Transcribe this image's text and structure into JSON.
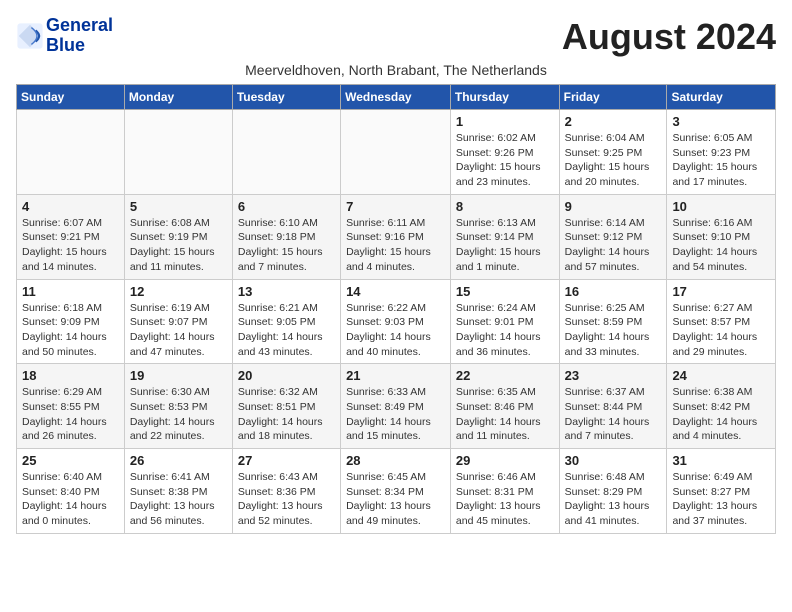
{
  "logo": {
    "line1": "General",
    "line2": "Blue"
  },
  "title": "August 2024",
  "subtitle": "Meerveldhoven, North Brabant, The Netherlands",
  "header_days": [
    "Sunday",
    "Monday",
    "Tuesday",
    "Wednesday",
    "Thursday",
    "Friday",
    "Saturday"
  ],
  "weeks": [
    [
      {
        "day": "",
        "detail": ""
      },
      {
        "day": "",
        "detail": ""
      },
      {
        "day": "",
        "detail": ""
      },
      {
        "day": "",
        "detail": ""
      },
      {
        "day": "1",
        "detail": "Sunrise: 6:02 AM\nSunset: 9:26 PM\nDaylight: 15 hours\nand 23 minutes."
      },
      {
        "day": "2",
        "detail": "Sunrise: 6:04 AM\nSunset: 9:25 PM\nDaylight: 15 hours\nand 20 minutes."
      },
      {
        "day": "3",
        "detail": "Sunrise: 6:05 AM\nSunset: 9:23 PM\nDaylight: 15 hours\nand 17 minutes."
      }
    ],
    [
      {
        "day": "4",
        "detail": "Sunrise: 6:07 AM\nSunset: 9:21 PM\nDaylight: 15 hours\nand 14 minutes."
      },
      {
        "day": "5",
        "detail": "Sunrise: 6:08 AM\nSunset: 9:19 PM\nDaylight: 15 hours\nand 11 minutes."
      },
      {
        "day": "6",
        "detail": "Sunrise: 6:10 AM\nSunset: 9:18 PM\nDaylight: 15 hours\nand 7 minutes."
      },
      {
        "day": "7",
        "detail": "Sunrise: 6:11 AM\nSunset: 9:16 PM\nDaylight: 15 hours\nand 4 minutes."
      },
      {
        "day": "8",
        "detail": "Sunrise: 6:13 AM\nSunset: 9:14 PM\nDaylight: 15 hours\nand 1 minute."
      },
      {
        "day": "9",
        "detail": "Sunrise: 6:14 AM\nSunset: 9:12 PM\nDaylight: 14 hours\nand 57 minutes."
      },
      {
        "day": "10",
        "detail": "Sunrise: 6:16 AM\nSunset: 9:10 PM\nDaylight: 14 hours\nand 54 minutes."
      }
    ],
    [
      {
        "day": "11",
        "detail": "Sunrise: 6:18 AM\nSunset: 9:09 PM\nDaylight: 14 hours\nand 50 minutes."
      },
      {
        "day": "12",
        "detail": "Sunrise: 6:19 AM\nSunset: 9:07 PM\nDaylight: 14 hours\nand 47 minutes."
      },
      {
        "day": "13",
        "detail": "Sunrise: 6:21 AM\nSunset: 9:05 PM\nDaylight: 14 hours\nand 43 minutes."
      },
      {
        "day": "14",
        "detail": "Sunrise: 6:22 AM\nSunset: 9:03 PM\nDaylight: 14 hours\nand 40 minutes."
      },
      {
        "day": "15",
        "detail": "Sunrise: 6:24 AM\nSunset: 9:01 PM\nDaylight: 14 hours\nand 36 minutes."
      },
      {
        "day": "16",
        "detail": "Sunrise: 6:25 AM\nSunset: 8:59 PM\nDaylight: 14 hours\nand 33 minutes."
      },
      {
        "day": "17",
        "detail": "Sunrise: 6:27 AM\nSunset: 8:57 PM\nDaylight: 14 hours\nand 29 minutes."
      }
    ],
    [
      {
        "day": "18",
        "detail": "Sunrise: 6:29 AM\nSunset: 8:55 PM\nDaylight: 14 hours\nand 26 minutes."
      },
      {
        "day": "19",
        "detail": "Sunrise: 6:30 AM\nSunset: 8:53 PM\nDaylight: 14 hours\nand 22 minutes."
      },
      {
        "day": "20",
        "detail": "Sunrise: 6:32 AM\nSunset: 8:51 PM\nDaylight: 14 hours\nand 18 minutes."
      },
      {
        "day": "21",
        "detail": "Sunrise: 6:33 AM\nSunset: 8:49 PM\nDaylight: 14 hours\nand 15 minutes."
      },
      {
        "day": "22",
        "detail": "Sunrise: 6:35 AM\nSunset: 8:46 PM\nDaylight: 14 hours\nand 11 minutes."
      },
      {
        "day": "23",
        "detail": "Sunrise: 6:37 AM\nSunset: 8:44 PM\nDaylight: 14 hours\nand 7 minutes."
      },
      {
        "day": "24",
        "detail": "Sunrise: 6:38 AM\nSunset: 8:42 PM\nDaylight: 14 hours\nand 4 minutes."
      }
    ],
    [
      {
        "day": "25",
        "detail": "Sunrise: 6:40 AM\nSunset: 8:40 PM\nDaylight: 14 hours\nand 0 minutes."
      },
      {
        "day": "26",
        "detail": "Sunrise: 6:41 AM\nSunset: 8:38 PM\nDaylight: 13 hours\nand 56 minutes."
      },
      {
        "day": "27",
        "detail": "Sunrise: 6:43 AM\nSunset: 8:36 PM\nDaylight: 13 hours\nand 52 minutes."
      },
      {
        "day": "28",
        "detail": "Sunrise: 6:45 AM\nSunset: 8:34 PM\nDaylight: 13 hours\nand 49 minutes."
      },
      {
        "day": "29",
        "detail": "Sunrise: 6:46 AM\nSunset: 8:31 PM\nDaylight: 13 hours\nand 45 minutes."
      },
      {
        "day": "30",
        "detail": "Sunrise: 6:48 AM\nSunset: 8:29 PM\nDaylight: 13 hours\nand 41 minutes."
      },
      {
        "day": "31",
        "detail": "Sunrise: 6:49 AM\nSunset: 8:27 PM\nDaylight: 13 hours\nand 37 minutes."
      }
    ]
  ]
}
